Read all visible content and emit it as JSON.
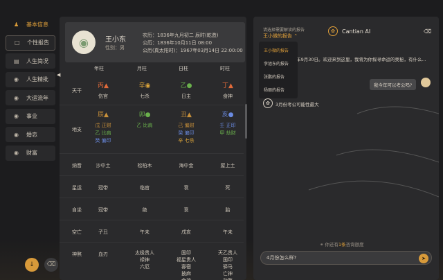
{
  "sidebar": {
    "items": [
      {
        "label": "基本信息",
        "icon": "user-icon"
      },
      {
        "label": "个性报告",
        "icon": "report-icon"
      },
      {
        "label": "人生简况",
        "icon": "book-icon"
      },
      {
        "label": "人生精批",
        "icon": "lock-icon"
      },
      {
        "label": "大运流年",
        "icon": "lock-icon"
      },
      {
        "label": "事业",
        "icon": "lock-icon"
      },
      {
        "label": "婚恋",
        "icon": "lock-icon"
      },
      {
        "label": "财富",
        "icon": "lock-icon"
      }
    ]
  },
  "profile": {
    "name": "王小东",
    "gender": "性别：男",
    "lunar": "农历：1836年九月初二 辰时(乾造)",
    "solar": "公历：1836年10月11日 08:00",
    "true_solar": "公历(真太阳时)：1967年03月14日 22:00:00"
  },
  "chart": {
    "columns": [
      "年柱",
      "月柱",
      "日柱",
      "时柱"
    ],
    "rows": {
      "tiangan": {
        "label": "天干",
        "stems": [
          "丙",
          "辛",
          "乙",
          "丁"
        ],
        "gods": [
          "伤官",
          "七杀",
          "日主",
          "食神"
        ]
      },
      "dizhi": {
        "label": "地支",
        "branches": [
          "辰",
          "卯",
          "丑",
          "亥"
        ],
        "hidden": [
          [
            "戊 正财",
            "乙 比肩",
            "癸 偏印"
          ],
          [
            "乙 比肩"
          ],
          [
            "己 偏财",
            "癸 偏印",
            "辛 七杀"
          ],
          [
            "壬 正印",
            "甲 劫财"
          ]
        ]
      },
      "nayin": {
        "label": "纳音",
        "values": [
          "沙中土",
          "松柏木",
          "海中金",
          "屋上土"
        ]
      },
      "xingyun": {
        "label": "星运",
        "values": [
          "冠带",
          "临官",
          "衰",
          "死"
        ]
      },
      "zizuo": {
        "label": "自坐",
        "values": [
          "冠带",
          "绝",
          "衰",
          "胎"
        ]
      },
      "kongwang": {
        "label": "空亡",
        "values": [
          "子丑",
          "午未",
          "戌亥",
          "午未"
        ]
      },
      "shensha": {
        "label": "神煞",
        "values": [
          [
            "血刃"
          ],
          [
            "太极贵人",
            "禄神",
            "六厄"
          ],
          [
            "国印",
            "福星贵人",
            "寡宿",
            "披麻",
            "金神"
          ],
          [
            "天乙贵人",
            "国印",
            "驿马",
            "亡神",
            "劫煞"
          ]
        ]
      }
    }
  },
  "chat": {
    "select_label": "请选择需要解读的报告",
    "selected": "王小微的报告",
    "options": [
      "王小微的报告",
      "李旭东的报告",
      "张鹏的报告",
      "杨丽的报告"
    ],
    "brand": "Cantian AI",
    "bot_msg1": "4年9月30日。欢迎来到这里，我将为你探寻命运的奥秘，有什么...",
    "user_msg": "我今年可以考公吗?",
    "bot_msg2": "3月份考公可能性最大",
    "quota_prefix": "你还有",
    "quota_count": "1条",
    "quota_suffix": "咨询额度",
    "input_value": "4月份怎么样?"
  }
}
